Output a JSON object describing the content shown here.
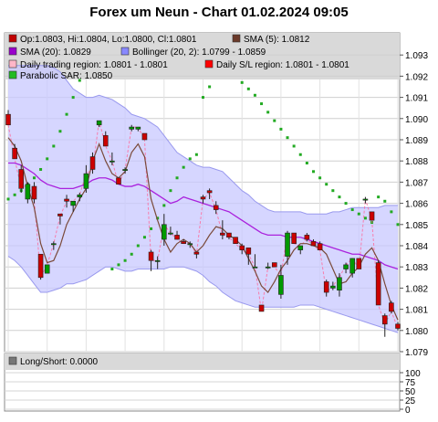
{
  "chart_data": [
    {
      "type": "candlestick",
      "title": "Forex um Neun - Chart 01.02.2024 09:05",
      "ylim": [
        1.079,
        1.0935
      ],
      "grid": true,
      "legend_position": "top",
      "yticks": [
        "1.093",
        "1.092",
        "1.091",
        "1.090",
        "1.089",
        "1.088",
        "1.087",
        "1.086",
        "1.085",
        "1.084",
        "1.083",
        "1.082",
        "1.081",
        "1.080",
        "1.079"
      ],
      "legend": [
        {
          "text": "Op:1.0803, Hi:1.0804, Lo:1.0800, Cl:1.0801",
          "color": "#c00000"
        },
        {
          "text": "SMA (5): 1.0812",
          "color": "#6b3a2a"
        },
        {
          "text": "SMA (20): 1.0829",
          "color": "#9900cc"
        },
        {
          "text": "Bollinger (20, 2): 1.0799 - 1.0859",
          "color": "#8888ff"
        },
        {
          "text": "Daily trading region: 1.0801 - 1.0801",
          "color": "#ffb6c8"
        },
        {
          "text": "Daily S/L region: 1.0801 - 1.0801",
          "color": "#ff0000"
        },
        {
          "text": "Parabolic SAR: 1.0850",
          "color": "#22bb22"
        }
      ],
      "colors": {
        "up": "#009900",
        "down": "#cc0000",
        "sma5": "#7a4a3a",
        "sma20": "#aa22dd",
        "bollinger_fill": "#c8c8ff",
        "sar": "#22aa22",
        "daily_region": "#ff6699"
      },
      "candles": [
        [
          1.0902,
          1.0904,
          1.0897,
          1.0897
        ],
        [
          1.0886,
          1.0888,
          1.0881,
          1.0881
        ],
        [
          1.0876,
          1.0878,
          1.0865,
          1.0867
        ],
        [
          1.0862,
          1.087,
          1.086,
          1.0869
        ],
        [
          1.0868,
          1.087,
          1.086,
          1.0862
        ],
        [
          1.0836,
          1.0836,
          1.0824,
          1.0825
        ],
        [
          1.0827,
          1.0831,
          1.0827,
          1.0831
        ],
        [
          1.0841,
          1.0842,
          1.0838,
          1.0841
        ],
        [
          1.0855,
          1.0855,
          1.085,
          1.0854
        ],
        [
          1.0862,
          1.0864,
          1.0858,
          1.0861
        ],
        [
          1.0859,
          1.0861,
          1.0856,
          1.0861
        ],
        [
          1.0863,
          1.0865,
          1.0861,
          1.0864
        ],
        [
          1.0867,
          1.0878,
          1.0865,
          1.0874
        ],
        [
          1.0882,
          1.0884,
          1.0874,
          1.0876
        ],
        [
          1.0897,
          1.0899,
          1.0896,
          1.0899
        ],
        [
          1.0892,
          1.0894,
          1.0887,
          1.0887
        ],
        [
          1.088,
          1.0884,
          1.0878,
          1.088
        ],
        [
          1.0872,
          1.0872,
          1.0869,
          1.0869
        ],
        [
          1.0876,
          1.0877,
          1.0874,
          1.0876
        ],
        [
          1.0895,
          1.0897,
          1.0894,
          1.0896
        ],
        [
          1.0895,
          1.0896,
          1.0894,
          1.0896
        ],
        [
          1.0893,
          1.0893,
          1.089,
          1.089
        ],
        [
          1.0837,
          1.0838,
          1.0828,
          1.0833
        ],
        [
          1.0833,
          1.0835,
          1.0829,
          1.0833
        ],
        [
          1.0843,
          1.0855,
          1.084,
          1.085
        ],
        [
          1.0846,
          1.0849,
          1.0845,
          1.0846
        ],
        [
          1.0845,
          1.0847,
          1.0843,
          1.0843
        ],
        [
          1.0842,
          1.0843,
          1.0841,
          1.0841
        ],
        [
          1.0841,
          1.0842,
          1.0839,
          1.0841
        ],
        [
          1.0837,
          1.0837,
          1.0834,
          1.0836
        ],
        [
          1.0863,
          1.0864,
          1.086,
          1.0862
        ],
        [
          1.0866,
          1.0867,
          1.0862,
          1.0865
        ],
        [
          1.0859,
          1.0861,
          1.0855,
          1.0857
        ],
        [
          1.0846,
          1.0852,
          1.0843,
          1.0845
        ],
        [
          1.0846,
          1.0846,
          1.0843,
          1.0844
        ],
        [
          1.0844,
          1.0844,
          1.0841,
          1.0841
        ],
        [
          1.084,
          1.0841,
          1.0836,
          1.0838
        ],
        [
          1.0839,
          1.0839,
          1.0831,
          1.0836
        ],
        [
          1.083,
          1.0836,
          1.083,
          1.083
        ],
        [
          1.0812,
          1.0812,
          1.0809,
          1.0809
        ],
        [
          1.083,
          1.0832,
          1.0829,
          1.083
        ],
        [
          1.0832,
          1.0832,
          1.083,
          1.083
        ],
        [
          1.0817,
          1.0831,
          1.0815,
          1.0826
        ],
        [
          1.0835,
          1.0847,
          1.0831,
          1.0846
        ],
        [
          1.0846,
          1.0846,
          1.0841,
          1.0841
        ],
        [
          1.0838,
          1.084,
          1.0836,
          1.084
        ],
        [
          1.0845,
          1.0846,
          1.0842,
          1.0843
        ],
        [
          1.0842,
          1.0843,
          1.084,
          1.084
        ],
        [
          1.0841,
          1.0842,
          1.0838,
          1.0838
        ],
        [
          1.0823,
          1.0824,
          1.0816,
          1.0818
        ],
        [
          1.082,
          1.0823,
          1.0819,
          1.0821
        ],
        [
          1.0819,
          1.0827,
          1.0816,
          1.0825
        ],
        [
          1.0829,
          1.0832,
          1.0827,
          1.0831
        ],
        [
          1.0827,
          1.0834,
          1.0825,
          1.0834
        ],
        [
          1.0834,
          1.0834,
          1.0829,
          1.0829
        ],
        [
          1.0862,
          1.0863,
          1.086,
          1.0862
        ],
        [
          1.0856,
          1.0856,
          1.0852,
          1.0852
        ],
        [
          1.0832,
          1.0833,
          1.0812,
          1.0812
        ],
        [
          1.0807,
          1.0808,
          1.0797,
          1.0803
        ],
        [
          1.0813,
          1.0814,
          1.0808,
          1.0809
        ],
        [
          1.0803,
          1.0804,
          1.08,
          1.0801
        ]
      ],
      "sma5": [
        1.0891,
        1.0887,
        1.088,
        1.0868,
        1.0858,
        1.0841,
        1.0832,
        1.0833,
        1.084,
        1.085,
        1.0856,
        1.0862,
        1.0867,
        1.088,
        1.0888,
        1.088,
        1.0874,
        1.0872,
        1.0875,
        1.0884,
        1.0888,
        1.0882,
        1.0862,
        1.0852,
        1.0843,
        1.0837,
        1.0841,
        1.0843,
        1.0841,
        1.0837,
        1.084,
        1.0845,
        1.0849,
        1.0848,
        1.0845,
        1.0843,
        1.084,
        1.0834,
        1.0828,
        1.0821,
        1.0818,
        1.0823,
        1.0829,
        1.0833,
        1.0838,
        1.0841,
        1.0841,
        1.084,
        1.0839,
        1.0836,
        1.0829,
        1.0822,
        1.0823,
        1.0827,
        1.083,
        1.0836,
        1.0839,
        1.0833,
        1.0822,
        1.0812,
        1.0805
      ],
      "sma20": [
        1.0879,
        1.0879,
        1.0878,
        1.0876,
        1.0874,
        1.0871,
        1.0869,
        1.0868,
        1.0867,
        1.0867,
        1.0867,
        1.0868,
        1.0869,
        1.0871,
        1.0872,
        1.0872,
        1.0871,
        1.0869,
        1.0868,
        1.0868,
        1.0869,
        1.0868,
        1.0866,
        1.0864,
        1.0862,
        1.086,
        1.0861,
        1.0863,
        1.0862,
        1.0861,
        1.086,
        1.0859,
        1.0858,
        1.0857,
        1.0856,
        1.0854,
        1.0852,
        1.085,
        1.0848,
        1.0846,
        1.0845,
        1.0845,
        1.0845,
        1.0844,
        1.0844,
        1.0844,
        1.0843,
        1.0842,
        1.0841,
        1.084,
        1.0839,
        1.0838,
        1.0837,
        1.0836,
        1.0836,
        1.0835,
        1.0834,
        1.0833,
        1.0831,
        1.083,
        1.0829
      ],
      "bollinger_upper": [
        1.0925,
        1.0925,
        1.0925,
        1.0925,
        1.0925,
        1.0925,
        1.0925,
        1.0924,
        1.0922,
        1.0918,
        1.0914,
        1.0912,
        1.091,
        1.091,
        1.0911,
        1.091,
        1.0909,
        1.0907,
        1.0905,
        1.0902,
        1.0901,
        1.09,
        1.0898,
        1.0896,
        1.0892,
        1.0888,
        1.0884,
        1.0882,
        1.088,
        1.0878,
        1.0877,
        1.0877,
        1.0876,
        1.0875,
        1.0872,
        1.0869,
        1.0866,
        1.0864,
        1.0861,
        1.0859,
        1.0857,
        1.0856,
        1.0856,
        1.0856,
        1.0856,
        1.0856,
        1.0855,
        1.0855,
        1.0855,
        1.0855,
        1.0856,
        1.0856,
        1.0857,
        1.0858,
        1.0858,
        1.0858,
        1.0858,
        1.0858,
        1.0859,
        1.0859,
        1.0859
      ],
      "bollinger_lower": [
        1.0835,
        1.0833,
        1.083,
        1.0826,
        1.0822,
        1.0818,
        1.0818,
        1.0819,
        1.082,
        1.0822,
        1.0822,
        1.0823,
        1.0824,
        1.0826,
        1.0828,
        1.083,
        1.083,
        1.0829,
        1.0828,
        1.0828,
        1.0829,
        1.0829,
        1.0829,
        1.0829,
        1.0829,
        1.083,
        1.083,
        1.083,
        1.0829,
        1.0828,
        1.0826,
        1.0823,
        1.0821,
        1.0818,
        1.0816,
        1.0814,
        1.0813,
        1.0812,
        1.0811,
        1.0811,
        1.0811,
        1.0811,
        1.0811,
        1.0811,
        1.0811,
        1.0812,
        1.0812,
        1.0812,
        1.0811,
        1.081,
        1.0809,
        1.0808,
        1.0807,
        1.0806,
        1.0805,
        1.0804,
        1.0803,
        1.0802,
        1.0801,
        1.08,
        1.0799
      ],
      "sar": [
        1.0862,
        1.0864,
        1.0866,
        1.0869,
        1.0872,
        1.0876,
        1.0881,
        1.0887,
        1.0894,
        1.0902,
        1.091,
        1.0918,
        1.0924,
        1.0927,
        1.0929,
        1.093,
        1.0829,
        1.0831,
        1.0833,
        1.0836,
        1.084,
        1.0844,
        1.0848,
        1.0853,
        1.0859,
        1.0866,
        1.0872,
        1.0877,
        1.0881,
        1.0883,
        1.091,
        1.0915,
        1.092,
        1.0922,
        1.0921,
        1.0919,
        1.0917,
        1.0914,
        1.0911,
        1.0907,
        1.0903,
        1.0899,
        1.0895,
        1.0891,
        1.0887,
        1.0883,
        1.0879,
        1.0875,
        1.0872,
        1.0869,
        1.0866,
        1.0863,
        1.086,
        1.0857,
        1.0855,
        1.0853,
        1.0851,
        1.0863,
        1.0861,
        1.0856,
        1.085
      ]
    },
    {
      "type": "line",
      "title": "",
      "legend": [
        {
          "text": "Long/Short: 0.0000",
          "color": "#777777"
        }
      ],
      "ylim": [
        0,
        110
      ],
      "yticks": [
        "100",
        "75",
        "50",
        "25",
        "0"
      ],
      "series": [
        {
          "name": "Long/Short",
          "values": [
            0
          ]
        }
      ]
    }
  ]
}
